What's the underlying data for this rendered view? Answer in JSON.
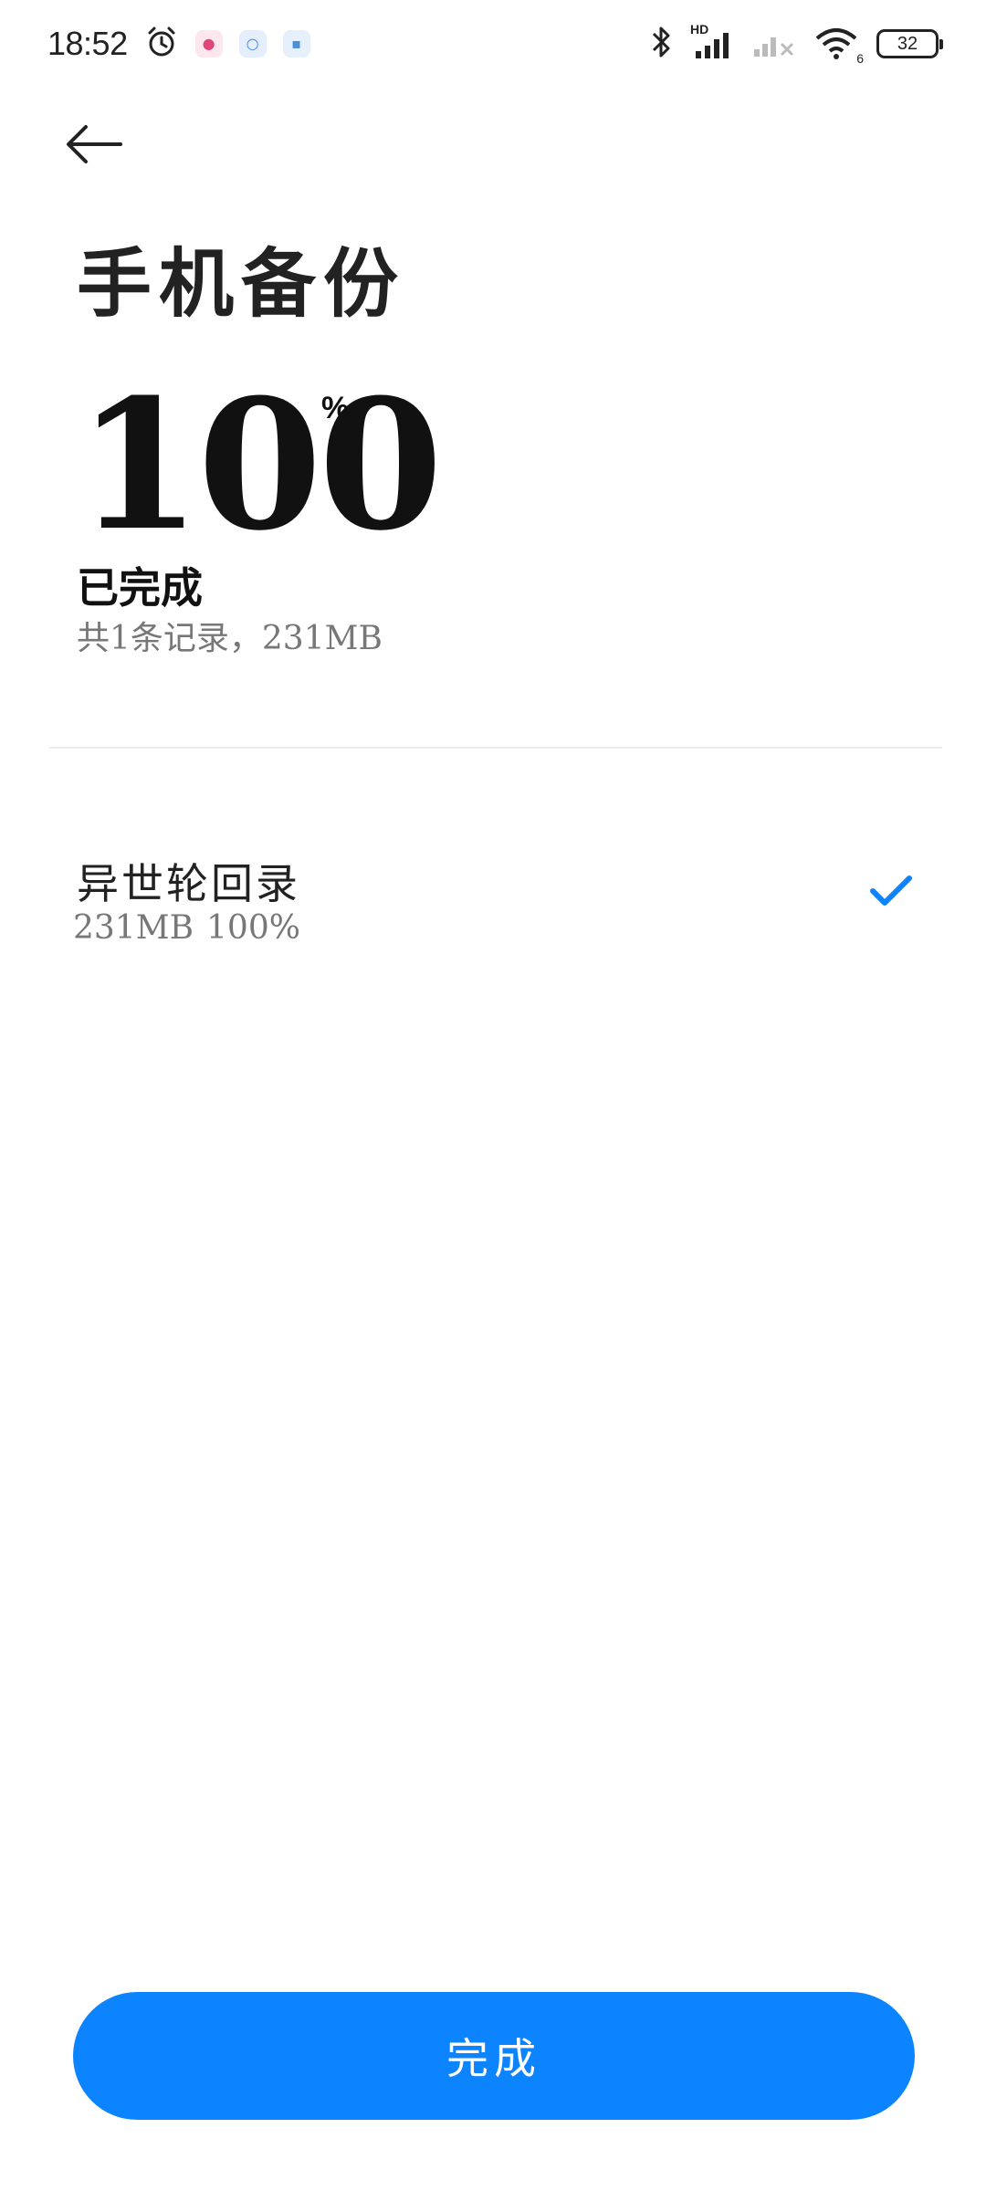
{
  "status_bar": {
    "time": "18:52",
    "battery": "32",
    "network_badge": "HD",
    "wifi_badge": "6"
  },
  "header": {
    "title": "手机备份"
  },
  "progress": {
    "value": "100",
    "unit": "%",
    "status": "已完成",
    "summary": "共1条记录，231MB"
  },
  "items": [
    {
      "title": "异世轮回录",
      "size": "231MB",
      "percent": "100%",
      "done": true
    }
  ],
  "footer": {
    "done_label": "完成"
  },
  "colors": {
    "accent": "#0d84ff",
    "text_primary": "#222222",
    "text_secondary": "#777777"
  }
}
